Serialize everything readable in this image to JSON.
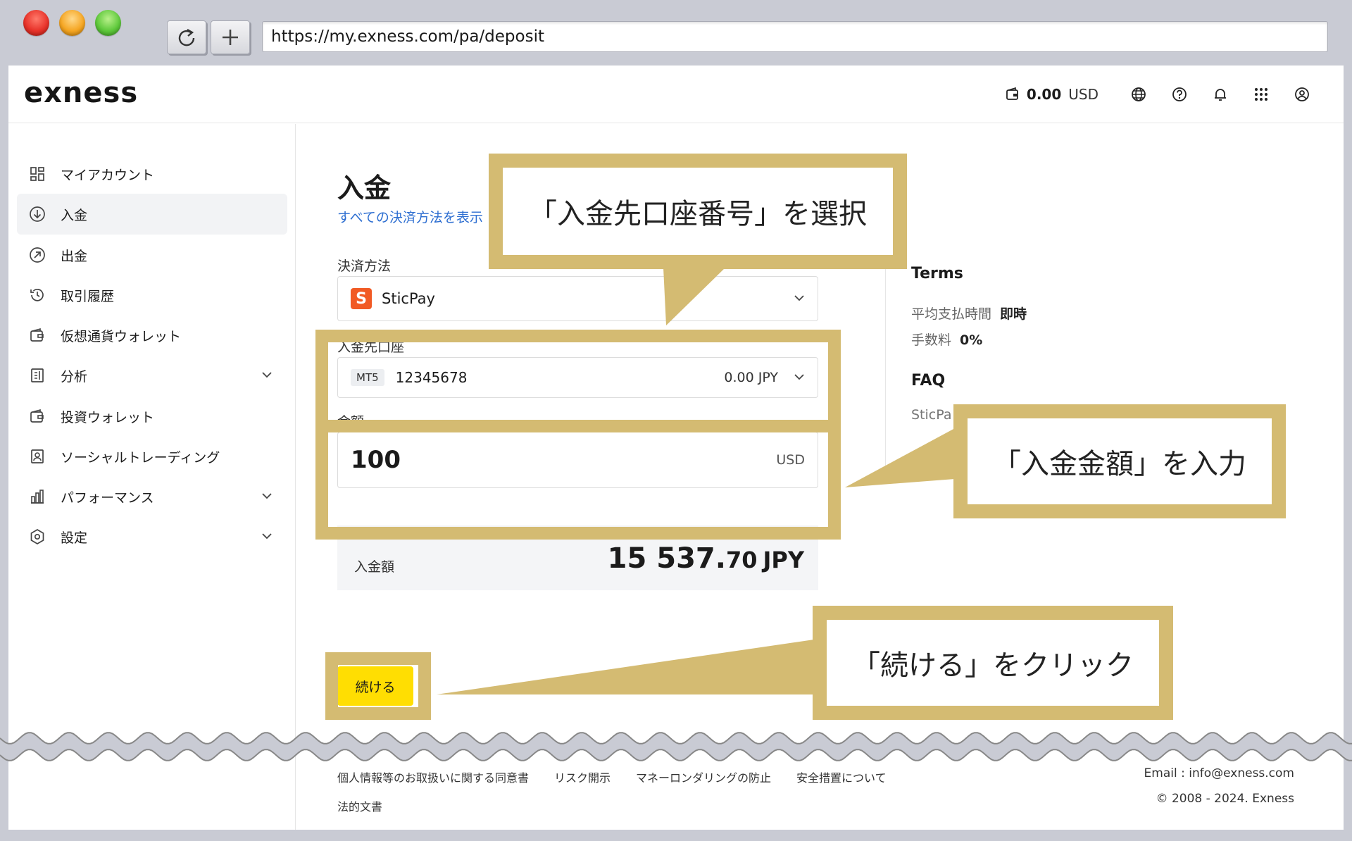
{
  "browser": {
    "url": "https://my.exness.com/pa/deposit",
    "reload_icon": "reload-icon",
    "new_tab_icon": "plus-icon"
  },
  "header": {
    "logo": "exness",
    "balance_value": "0.00",
    "balance_currency": "USD",
    "icons": [
      "wallet-icon",
      "globe-icon",
      "help-icon",
      "bell-icon",
      "apps-grid-icon",
      "user-icon"
    ]
  },
  "sidebar": {
    "items": [
      {
        "label": "マイアカウント",
        "icon": "dashboard-icon"
      },
      {
        "label": "入金",
        "icon": "deposit-icon",
        "active": true
      },
      {
        "label": "出金",
        "icon": "withdraw-icon"
      },
      {
        "label": "取引履歴",
        "icon": "history-icon"
      },
      {
        "label": "仮想通貨ウォレット",
        "icon": "wallet-icon"
      },
      {
        "label": "分析",
        "icon": "analytics-icon",
        "expandable": true
      },
      {
        "label": "投資ウォレット",
        "icon": "wallet-icon"
      },
      {
        "label": "ソーシャルトレーディング",
        "icon": "social-icon"
      },
      {
        "label": "パフォーマンス",
        "icon": "chart-icon",
        "expandable": true
      },
      {
        "label": "設定",
        "icon": "settings-icon",
        "expandable": true
      }
    ]
  },
  "main": {
    "title": "入金",
    "show_all_link": "すべての決済方法を表示",
    "method_label": "決済方法",
    "method_value": "SticPay",
    "account_label": "入金先口座",
    "account_platform": "MT5",
    "account_number": "12345678",
    "account_balance": "0.00 JPY",
    "amount_label": "金額",
    "amount_value": "100",
    "amount_currency": "USD",
    "summary_label": "入金額",
    "summary_int": "15 537.",
    "summary_dec": "70",
    "summary_currency": "JPY",
    "continue_button": "続ける"
  },
  "terms": {
    "title": "Terms",
    "rows": [
      {
        "label": "平均支払時間",
        "value": "即時"
      },
      {
        "label": "手数料",
        "value": "0%"
      }
    ],
    "faq_title": "FAQ",
    "faq_item": "SticPa"
  },
  "footer": {
    "links": [
      "個人情報等のお取扱いに関する同意書",
      "リスク開示",
      "マネーロンダリングの防止",
      "安全措置について"
    ],
    "legal": "法的文書",
    "email": "Email :  info@exness.com",
    "copyright": "© 2008 - 2024. Exness"
  },
  "callouts": {
    "account": "「入金先口座番号」を選択",
    "amount": "「入金金額」を入力",
    "continue": "「続ける」をクリック"
  },
  "colors": {
    "callout_border": "#d4bb72",
    "button_yellow": "#ffde02",
    "link_blue": "#2d6ed1"
  }
}
